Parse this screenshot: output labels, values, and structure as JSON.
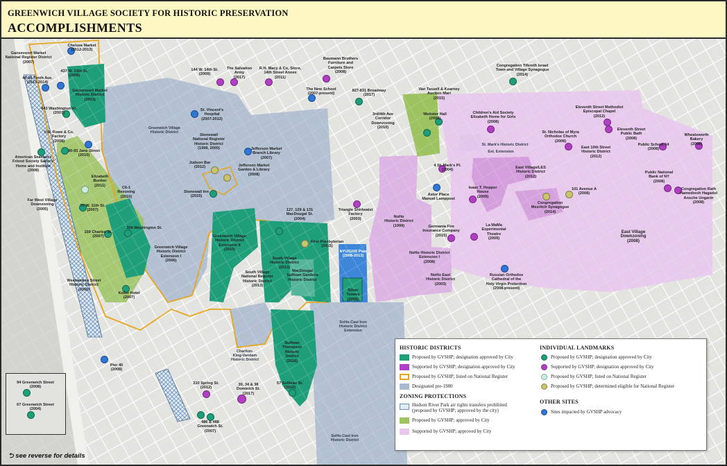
{
  "header": {
    "org": "GREENWICH VILLAGE SOCIETY FOR HISTORIC PRESERVATION",
    "title": "ACCOMPLISHMENTS"
  },
  "colors": {
    "gvshp_approved": "#1f9e7a",
    "supported_city": "#b13fc4",
    "national_register": "#e7a51c",
    "designated_pre1980": "#a9bad0",
    "hudson_transfer": "#cfe3f2",
    "zoning_gvshp": "#9cc360",
    "zoning_supported": "#e8c6ee",
    "eligible": "#c9c46e",
    "other_sites": "#2f76d6"
  },
  "labels": [
    {
      "id": "gansevoort-nr",
      "text": "Gansevoort Market\nNational Register District\n(2007)"
    },
    {
      "id": "chelsea-market",
      "text": "Chelsea Market\n(2012-2013)"
    },
    {
      "id": "west-13th",
      "text": "437 W. 13th St.\n(2008)"
    },
    {
      "id": "gansevoort-hd",
      "text": "Gansevoort Market\nHistoric District\n(2003)"
    },
    {
      "id": "tenth-ave",
      "text": "40-56 Tenth Ave.\n(2013-2014)"
    },
    {
      "id": "washington-st-643",
      "text": "643 Washington St.\n(2007)"
    },
    {
      "id": "ofa-rowe",
      "text": "V.B. Rowe & Co.\nFactory\n(2008)"
    },
    {
      "id": "jane-st",
      "text": "90-93 Jane Street\n(2010)"
    },
    {
      "id": "american-seamans",
      "text": "American Seaman's\nFriend Society Sailors'\nHome and Institute\n(2008)"
    },
    {
      "id": "elizabeth-bunker",
      "text": "Elizabeth\nBunker\n(2011)"
    },
    {
      "id": "c6-1-rezoning",
      "text": "C6-1\nRezoning\n(2010)"
    },
    {
      "id": "far-west-village",
      "text": "Far West Village\nDownzoning\n(2005)"
    },
    {
      "id": "w-11th",
      "text": "70 W. 11th St.\n(2007)"
    },
    {
      "id": "charles-st-159",
      "text": "159 Charles St.\n(2007)"
    },
    {
      "id": "washington-st-354",
      "text": "354 Washington St."
    },
    {
      "id": "gv-ext-1",
      "text": "Greenwich Village\nHistoric District\nExtension I\n(2006)"
    },
    {
      "id": "weehawken",
      "text": "Weehawken Street\nHistoric District\n(2006)"
    },
    {
      "id": "keller-hotel",
      "text": "Keller Hotel\n(2007)"
    },
    {
      "id": "w14th-144",
      "text": "144 W. 14th St.\n(2009)"
    },
    {
      "id": "salvation-army",
      "text": "The Salvation Army\n(2017)"
    },
    {
      "id": "rh-macy",
      "text": "R.H. Macy & Co. Store,\n14th Street Annex\n(2011)"
    },
    {
      "id": "baumann",
      "text": "Baumann Brothers\nFurniture and\nCarpets Store\n(2008)"
    },
    {
      "id": "new-school",
      "text": "The New School\n(2007-present)"
    },
    {
      "id": "broadway-827",
      "text": "827-831 Broadway\n(2017)"
    },
    {
      "id": "st-vincents",
      "text": "St. Vincent's\nHospital\n(2007-2012)"
    },
    {
      "id": "stonewall-nr",
      "text": "Stonewall\nNational Register\nHistoric District\n(1999, 2000)"
    },
    {
      "id": "jefferson-market-library",
      "text": "Jefferson Market\nBranch Library\n(2007)"
    },
    {
      "id": "judson-bar",
      "text": "Judson Bar\n(2012)"
    },
    {
      "id": "jefferson-market-garden",
      "text": "Jefferson Market\nGarden & Library\n(2008)"
    },
    {
      "id": "stonewall-inn",
      "text": "Stonewall Inn\n(2015)"
    },
    {
      "id": "macdougal-127",
      "text": "127, 129 & 131\nMacDougal St.\n(2004)"
    },
    {
      "id": "triangle-factory",
      "text": "Triangle Shirtwaist\nFactory\n(2003)"
    },
    {
      "id": "first-pavilion",
      "text": "First Presbyterian\n(2015)"
    },
    {
      "id": "gv-ext-2",
      "text": "Greenwich Village\nHistoric District\nExtension II\n(2010)"
    },
    {
      "id": "south-village-hd",
      "text": "South Village\nHistoric District\n(2013)"
    },
    {
      "id": "south-village-nr",
      "text": "South Village\nNational Register\nHistoric District\n(2013)"
    },
    {
      "id": "macdougal-sullivan",
      "text": "MacDougal\nSullivan Gardens\nHistoric District"
    },
    {
      "id": "sullivan-thompson",
      "text": "Sullivan\nThompson\nHistoric\nDistrict\n(2016)"
    },
    {
      "id": "nyu-plan",
      "text": "NYU/GHS Plan\n(2008-2013)"
    },
    {
      "id": "silver-towers",
      "text": "Silver Towers\n(2008)"
    },
    {
      "id": "ani-tanual",
      "text": "Van Tassell & Kearney\nAuction Mart\n(2015)"
    },
    {
      "id": "third-ave",
      "text": "3rd/4th Ave\nCorridor\nDownzoning\n(2010)"
    },
    {
      "id": "webster-hall",
      "text": "Webster Hall\n(2008)"
    },
    {
      "id": "childrens-aid",
      "text": "Children's Aid Society\nElizabeth Home for Girls\n(2008)"
    },
    {
      "id": "tifereth-israel",
      "text": "Congregation Tifereth Israel\nTown and Village Synagogue\n(2014)"
    },
    {
      "id": "eleventh-methodist",
      "text": "Eleventh Street Methodist\nEpiscopal Chapel\n(2012)"
    },
    {
      "id": "st-nicholas",
      "text": "St. Nicholas of Myra\nOrthodox Church\n(2008)"
    },
    {
      "id": "eleventh-bath",
      "text": "Eleventh Street\nPublic Bath\n(2008)"
    },
    {
      "id": "wheatsworth",
      "text": "Wheatsworth\nBakery\n(2008)"
    },
    {
      "id": "ps64",
      "text": "Public School 64\n(2008)"
    },
    {
      "id": "east10th",
      "text": "East 10th Street\nHistoric District\n(2012)"
    },
    {
      "id": "st-marks-pl",
      "text": "4 St. Mark's Pl.\n(2004)"
    },
    {
      "id": "ev-les",
      "text": "East Village/LES\nHistoric District\n(2012)"
    },
    {
      "id": "national-bank",
      "text": "Public National\nBank of NY\n(2008)"
    },
    {
      "id": "astor-lamppost",
      "text": "Astor Place\nManuel Lamppost"
    },
    {
      "id": "isaac-hopper",
      "text": "Isaac T. Hopper\nHouse\n(2009)"
    },
    {
      "id": "ave-a-101",
      "text": "101 Avenue A\n(2008)"
    },
    {
      "id": "congregation-mesivtha",
      "text": "Congregation\nMezritch Synagogue\n(2014)"
    },
    {
      "id": "congregation-rath",
      "text": "Congregation Rath\nHamedresh Hagadol\nAnsche Ungarin\n(2008)"
    },
    {
      "id": "noho-hd",
      "text": "NoHo\nHistoric District\n(1999)"
    },
    {
      "id": "germania",
      "text": "Germania Fire\nInsurance Company\n(2015)"
    },
    {
      "id": "la-mama",
      "text": "La MaMa\nExperimental\nTheatre\n(2009)"
    },
    {
      "id": "noho-ext",
      "text": "NoHo Historic District\nExtension I\n(2008)"
    },
    {
      "id": "noho-east",
      "text": "NoHo East\nHistoric District\n(2003)"
    },
    {
      "id": "russian-orthodox",
      "text": "Russian Orthodox\nCathedral of the\nHoly Virgin Protection\n(2008-present)"
    },
    {
      "id": "ev-downzoning",
      "text": "East Village\nDownzoning\n(2008)"
    },
    {
      "id": "spring-st-210",
      "text": "210 Spring St.\n(2012)"
    },
    {
      "id": "dominick",
      "text": "30, 34 & 38\nDominick St.\n(2017)"
    },
    {
      "id": "sullivan-57",
      "text": "57 Sullivan St.\n(2016)"
    },
    {
      "id": "greenwich-486",
      "text": "486 & 488\nGreenwich St.\n(2007)"
    },
    {
      "id": "pier40",
      "text": "Pier 40\n(2008)"
    }
  ],
  "district_labels": [
    {
      "id": "gv-hd",
      "text": "Greenwich Village\nHistoric District"
    },
    {
      "id": "st-marks-hd",
      "text": "St. Mark's Historic District"
    },
    {
      "id": "st-marks-ext",
      "text": "Ext. Extension"
    },
    {
      "id": "charlton",
      "text": "Charlton-\nKing-Vandam\nHistoric District"
    },
    {
      "id": "soho-cast-iron-ext",
      "text": "SoHo-Cast Iron\nHistoric District\nExtension"
    },
    {
      "id": "soho-cast-iron",
      "text": "SoHo-Cast Iron\nHistoric District"
    }
  ],
  "inset": {
    "items": [
      {
        "id": "greenwich-94",
        "text": "94 Greenwich Street\n(2008)"
      },
      {
        "id": "greenwich-67",
        "text": "67 Greenwich Street\n(2004)"
      }
    ]
  },
  "footer": {
    "reverse": "see reverse for details",
    "reverse_icon": "undo-arrow-icon"
  },
  "legend": {
    "historic_districts": {
      "heading": "HISTORIC DISTRICTS",
      "items": [
        {
          "text": "Proposed by GVSHP; designation approved by City",
          "color": "#1f9e7a"
        },
        {
          "text": "Supported by GVSHP; designation approved by City",
          "color": "#b13fc4"
        },
        {
          "text": "Proposed by GVSHP; listed on National Register",
          "color": "#e7a51c"
        },
        {
          "text": "Designated pre-1980",
          "color": "#a9bad0"
        }
      ]
    },
    "zoning": {
      "heading": "ZONING PROTECTIONS",
      "items": [
        {
          "text": "Hudson River Park air rights transfers prohibited\n(proposed by GVSHP; approved by the city)",
          "color": "#cfe3f2"
        },
        {
          "text": "Proposed by GVSHP; approved by City",
          "color": "#9cc360"
        },
        {
          "text": "Supported by GVSHP; approved by City",
          "color": "#e8c6ee"
        }
      ]
    },
    "individual_landmarks": {
      "heading": "INDIVIDUAL LANDMARKS",
      "items": [
        {
          "text": "Proposed by GVSHP; designation approved by City",
          "color": "#1f9e7a"
        },
        {
          "text": "Supported by GVSHP; designation approved by City",
          "color": "#b13fc4"
        },
        {
          "text": "Proposed by GVSHP; listed on National Register",
          "color": "#c8f0dc"
        },
        {
          "text": "Proposed by GVSHP; determined eligible for National Register",
          "color": "#c9c46e"
        }
      ]
    },
    "other_sites": {
      "heading": "OTHER SITES",
      "items": [
        {
          "text": "Sites impacted by GVSHP advocacy",
          "color": "#2f76d6"
        }
      ]
    }
  }
}
